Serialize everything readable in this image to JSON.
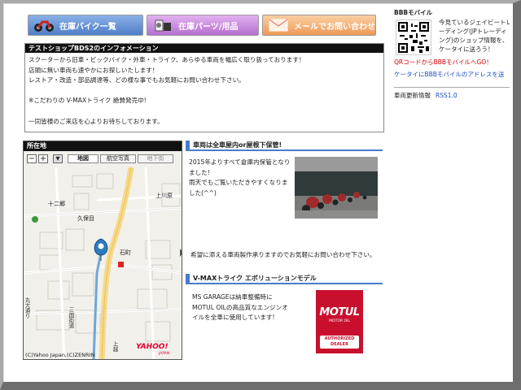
{
  "nav": {
    "bikes_label": "在庫バイク一覧",
    "parts_label": "在庫パーツ/用品",
    "mail_label": "メールでお問い合わせ"
  },
  "info": {
    "title": "テストショップBDS2のインフォメーション",
    "lines": [
      "スクーターから旧車・ビックバイク・外車・トライク、あらゆる車両を幅広く取り扱っております！",
      "店頭に無い車両も速やかにお探しいたします！",
      "レストア・改造・部品調達等、どの様な事でもお気軽にお問い合わせ下さい。",
      "",
      "※こだわりの V-MAXトライク 絶賛発売中!",
      "",
      "一同皆様のご来店を心よりお待ちしております。"
    ]
  },
  "sidebar": {
    "title": "BBBモバイル",
    "desc": "今見ているジェイビートレーディング(JPトレーディング)のショップ情報を、ケータイに送ろう！",
    "qr_link": "QRコードからBBBモバイルへGO！",
    "mail_link": "ケータイにBBBモバイルのアドレスを送",
    "updates_label": "車両更新情報",
    "rss_label": "RSS1.0"
  },
  "map": {
    "title": "所在地",
    "zoom_in": "+",
    "zoom_out": "−",
    "tabs": [
      "地図",
      "航空写真",
      "地下街"
    ],
    "places": [
      "十二郷",
      "久保目",
      "上川原",
      "石町"
    ],
    "copyright": "(C)Yahoo Japan,(C)ZENRIN",
    "brand": "YAHOO!",
    "brand_sub": "JAPAN"
  },
  "sections": {
    "storage_title": "車両は全車屋内or屋根下保管!",
    "storage_text": [
      "2015年よりすべて倉庫内保管となりました!",
      "雨天でもご覧いただきやすくなりました(^^)"
    ],
    "request_text": "希望に添える車両製作承りますのでお気軽にお問い合わせ下さい。",
    "vmax_title": "V-MAXトライク エボリューションモデル",
    "vmax_text": [
      "MS GARAGEは納車整備時に",
      "MOTUL OILの高品質なエンジンオ",
      "イルを全車に使用しています!"
    ],
    "motul_brand": "MOTUL",
    "motul_sub": "MOTOR OIL",
    "motul_badge": [
      "AUTHORIZED",
      "DEALER"
    ]
  },
  "colors": {
    "nav_blue": "#4f7fc9",
    "nav_purple": "#b56fd0",
    "nav_orange": "#ef9a56",
    "link_blue": "#1a4fc7",
    "alert_red": "#c00000",
    "section_bar": "#4a7bc8"
  }
}
